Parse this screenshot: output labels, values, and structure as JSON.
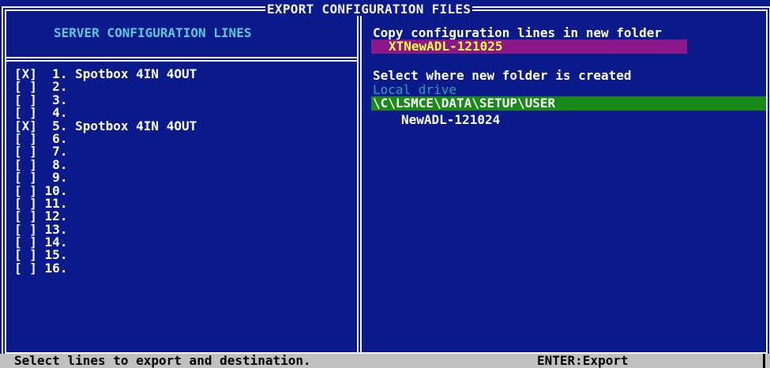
{
  "window": {
    "title": "EXPORT CONFIGURATION FILES"
  },
  "left_panel": {
    "header": "SERVER CONFIGURATION LINES",
    "lines": [
      {
        "check": "[X]",
        "num": " 1.",
        "name": "Spotbox 4IN 4OUT"
      },
      {
        "check": "[ ]",
        "num": " 2.",
        "name": ""
      },
      {
        "check": "[ ]",
        "num": " 3.",
        "name": ""
      },
      {
        "check": "[ ]",
        "num": " 4.",
        "name": ""
      },
      {
        "check": "[X]",
        "num": " 5.",
        "name": "Spotbox 4IN 4OUT"
      },
      {
        "check": "[ ]",
        "num": " 6.",
        "name": ""
      },
      {
        "check": "[ ]",
        "num": " 7.",
        "name": ""
      },
      {
        "check": "[ ]",
        "num": " 8.",
        "name": ""
      },
      {
        "check": "[ ]",
        "num": " 9.",
        "name": ""
      },
      {
        "check": "[ ]",
        "num": "10.",
        "name": ""
      },
      {
        "check": "[ ]",
        "num": "11.",
        "name": ""
      },
      {
        "check": "[ ]",
        "num": "12.",
        "name": ""
      },
      {
        "check": "[ ]",
        "num": "13.",
        "name": ""
      },
      {
        "check": "[ ]",
        "num": "14.",
        "name": ""
      },
      {
        "check": "[ ]",
        "num": "15.",
        "name": ""
      },
      {
        "check": "[ ]",
        "num": "16.",
        "name": ""
      }
    ]
  },
  "right_panel": {
    "header": "Copy configuration lines in new folder",
    "new_folder_value": "XTNewADL-121025",
    "select_label": "Select where new folder is created",
    "drive_label": "Local drive",
    "current_path": "\\C\\LSMCE\\DATA\\SETUP\\USER",
    "folders": [
      "NewADL-121024"
    ]
  },
  "status_bar": {
    "hint": "Select lines to export and destination.",
    "key_hint": "ENTER:Export"
  },
  "colors": {
    "background": "#0a1a8a",
    "input_bg": "#8a1888",
    "input_text": "#ffff40",
    "path_bg": "#178a17",
    "header_text": "#58c8d8",
    "status_bg": "#c0c0c0"
  }
}
